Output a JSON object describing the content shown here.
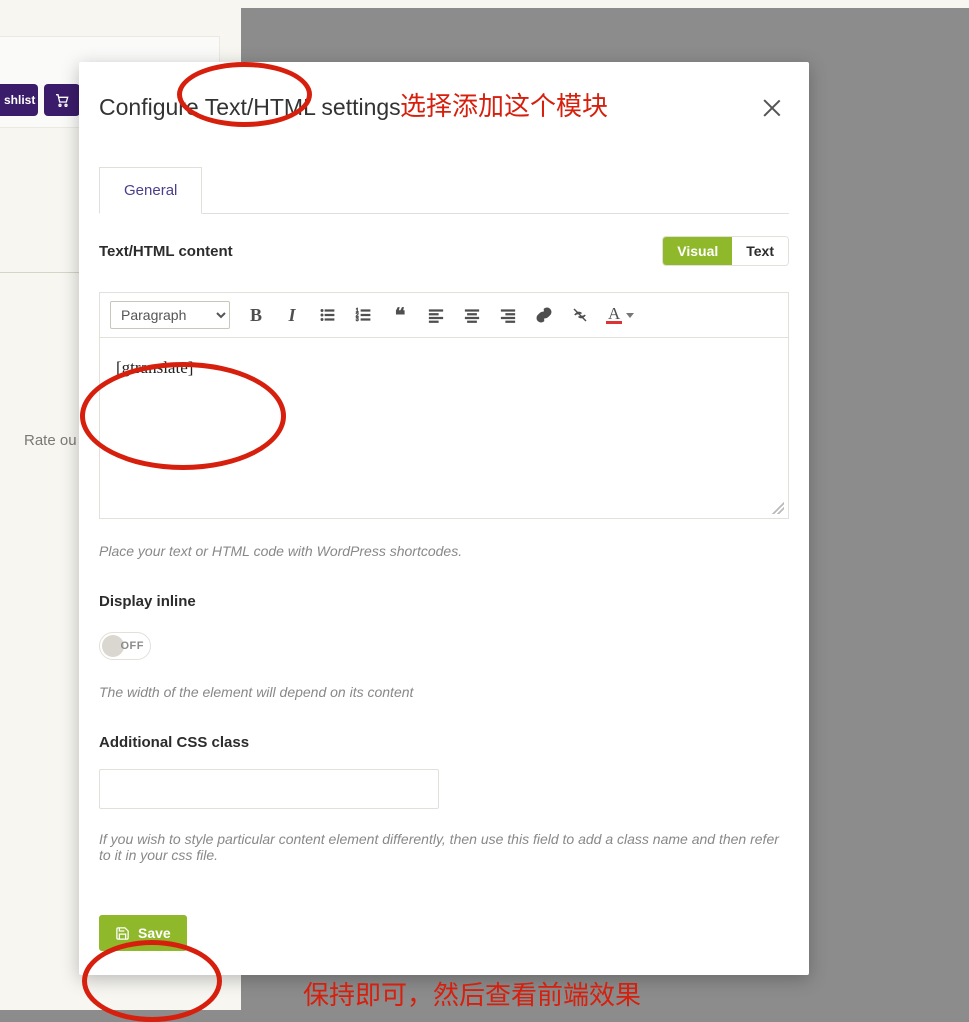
{
  "background": {
    "wishlist_btn": "shlist",
    "rate_text": "Rate ou"
  },
  "modal": {
    "title": "Configure Text/HTML settings",
    "tabs": {
      "general": "General"
    },
    "content_section_label": "Text/HTML content",
    "mode": {
      "visual": "Visual",
      "text": "Text"
    },
    "format_select": "Paragraph",
    "editor_text": "[gtranslate]",
    "content_help": "Place your text or HTML code with WordPress shortcodes.",
    "inline_label": "Display inline",
    "toggle_state": "OFF",
    "inline_help": "The width of the element will depend on its content",
    "css_label": "Additional CSS class",
    "css_value": "",
    "css_help": "If you wish to style particular content element differently, then use this field to add a class name and then refer to it in your css file.",
    "save_label": "Save"
  },
  "annotations": {
    "top_text": "选择添加这个模块",
    "bottom_text": "保持即可，然后查看前端效果"
  },
  "colors": {
    "accent_green": "#8fb92a",
    "annotation_red": "#d61f0d",
    "tab_text": "#4c3d8c"
  }
}
